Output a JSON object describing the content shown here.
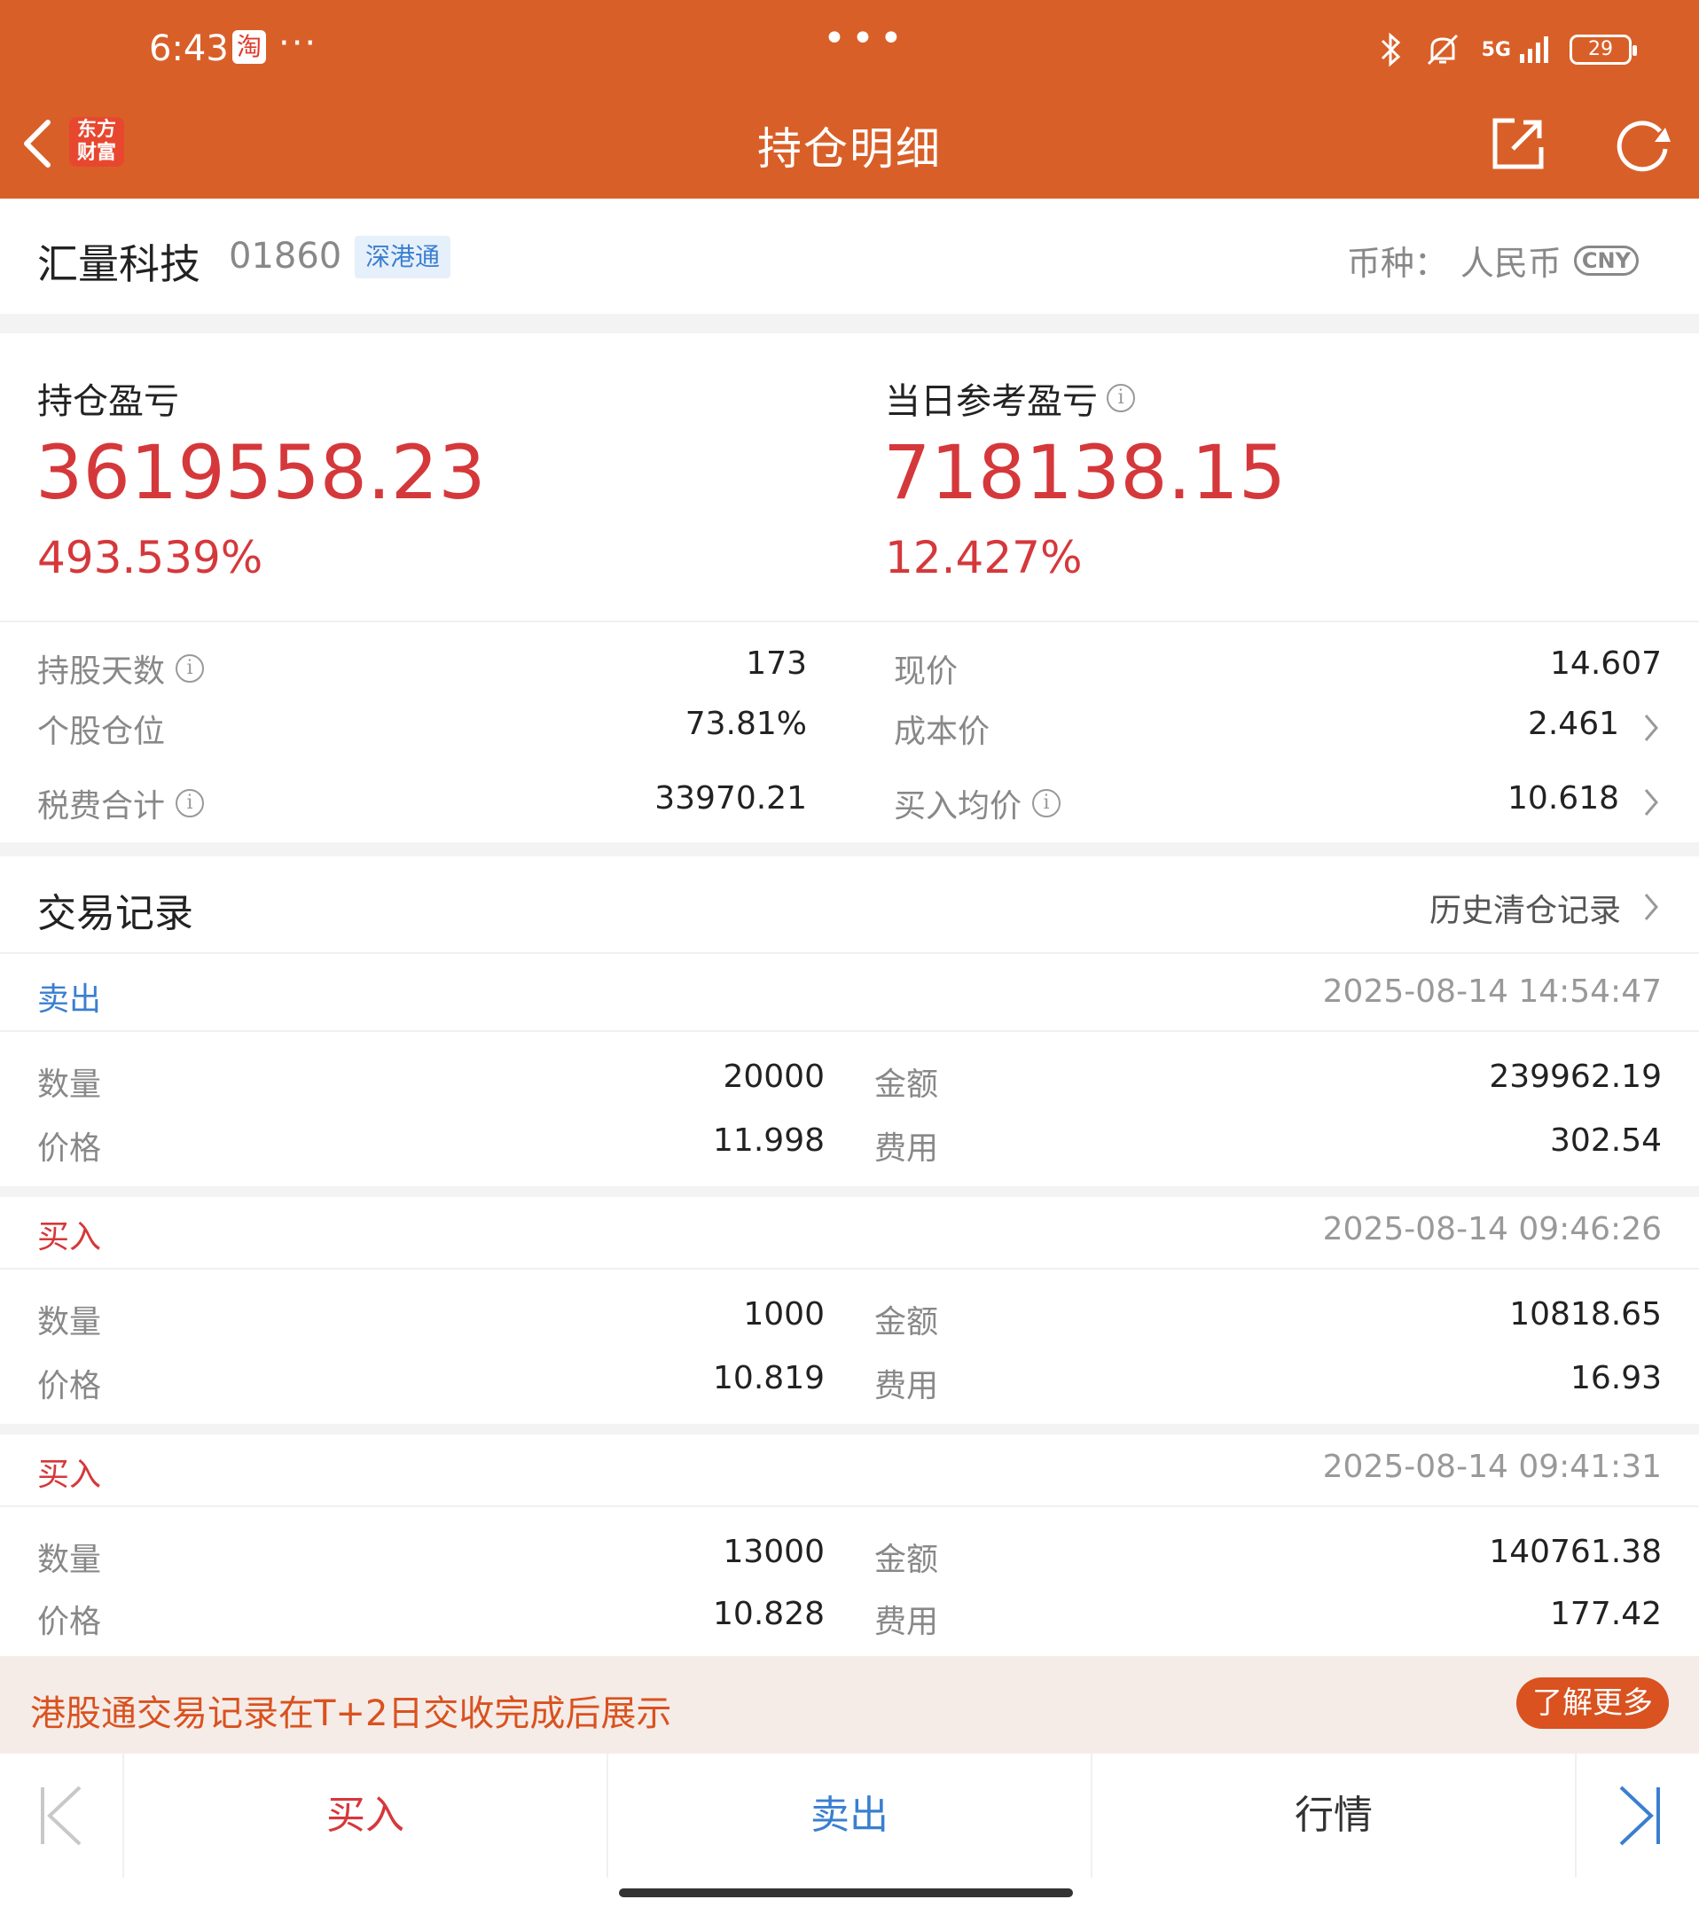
{
  "status_bar": {
    "time": "6:43",
    "app_badge": "淘",
    "dots_left": "···",
    "dots_center": "•••",
    "network": "5G",
    "battery": "29"
  },
  "header": {
    "logo_text": "东方财富",
    "title": "持仓明细"
  },
  "stock": {
    "name": "汇量科技",
    "code": "01860",
    "tag": "深港通",
    "currency_label": "币种：",
    "currency_value": "人民币",
    "currency_code": "CNY"
  },
  "pnl": {
    "holding_label": "持仓盈亏",
    "holding_value": "3619558.23",
    "holding_pct": "493.539%",
    "daily_label": "当日参考盈亏",
    "daily_value": "718138.15",
    "daily_pct": "12.427%"
  },
  "details": {
    "hold_days_label": "持股天数",
    "hold_days": "173",
    "position_label": "个股仓位",
    "position": "73.81%",
    "fees_label": "税费合计",
    "fees": "33970.21",
    "price_label": "现价",
    "price": "14.607",
    "cost_label": "成本价",
    "cost": "2.461",
    "avg_buy_label": "买入均价",
    "avg_buy": "10.618"
  },
  "trades": {
    "title": "交易记录",
    "history_link": "历史清仓记录",
    "qty_label": "数量",
    "price_label": "价格",
    "amount_label": "金额",
    "fee_label": "费用",
    "records": [
      {
        "type": "卖出",
        "time": "2025-08-14 14:54:47",
        "qty": "20000",
        "price": "11.998",
        "amount": "239962.19",
        "fee": "302.54"
      },
      {
        "type": "买入",
        "time": "2025-08-14 09:46:26",
        "qty": "1000",
        "price": "10.819",
        "amount": "10818.65",
        "fee": "16.93"
      },
      {
        "type": "买入",
        "time": "2025-08-14 09:41:31",
        "qty": "13000",
        "price": "10.828",
        "amount": "140761.38",
        "fee": "177.42"
      }
    ]
  },
  "notice": {
    "text": "港股通交易记录在T+2日交收完成后展示",
    "button": "了解更多"
  },
  "bottom_bar": {
    "buy": "买入",
    "sell": "卖出",
    "quote": "行情"
  },
  "colors": {
    "brand": "#d95f28",
    "rise": "#d5383b",
    "sell": "#3a7fd0"
  }
}
